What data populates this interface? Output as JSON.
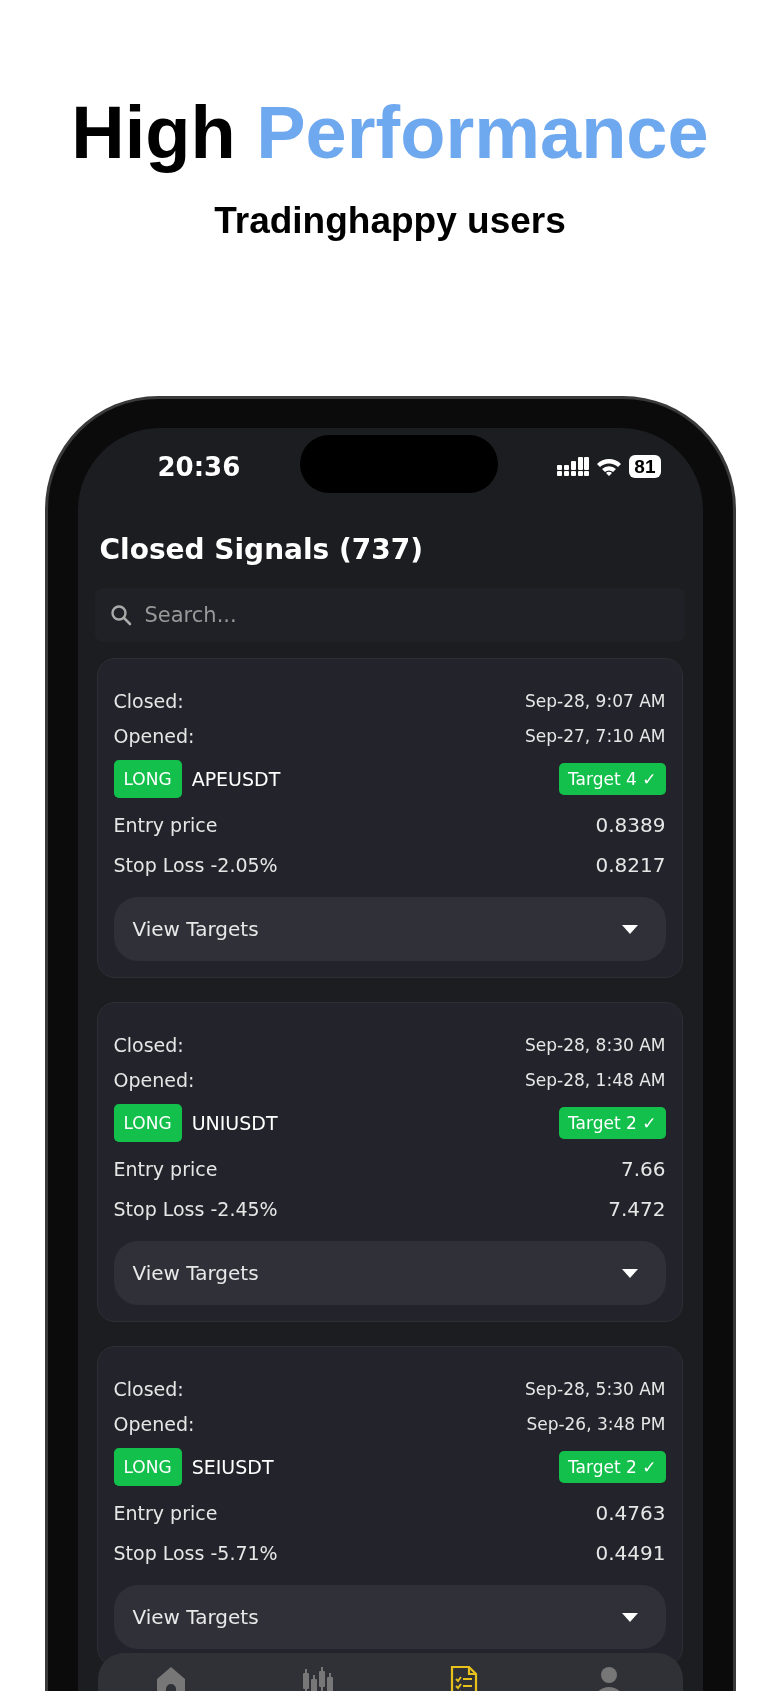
{
  "headline": {
    "text": "High",
    "highlight": "Performance"
  },
  "subtitle": "Tradinghappy users",
  "status_bar": {
    "time": "20:36",
    "battery": "81"
  },
  "title": "Closed Signals (737)",
  "search": {
    "placeholder": "Search..."
  },
  "signals": [
    {
      "closed_label": "Closed:",
      "closed": "Sep-28, 9:07 AM",
      "opened_label": "Opened:",
      "opened": "Sep-27, 7:10 AM",
      "side": "LONG",
      "pair": "APEUSDT",
      "result": "Target 4 ✓",
      "entry_label": "Entry price",
      "entry": "0.8389",
      "stop_label": "Stop Loss -2.05%",
      "stop": "0.8217",
      "button": "View Targets"
    },
    {
      "closed_label": "Closed:",
      "closed": "Sep-28, 8:30 AM",
      "opened_label": "Opened:",
      "opened": "Sep-28, 1:48 AM",
      "side": "LONG",
      "pair": "UNIUSDT",
      "result": "Target 2 ✓",
      "entry_label": "Entry price",
      "entry": "7.66",
      "stop_label": "Stop Loss -2.45%",
      "stop": "7.472",
      "button": "View Targets"
    },
    {
      "closed_label": "Closed:",
      "closed": "Sep-28, 5:30 AM",
      "opened_label": "Opened:",
      "opened": "Sep-26, 3:48 PM",
      "side": "LONG",
      "pair": "SEIUSDT",
      "result": "Target 2 ✓",
      "entry_label": "Entry price",
      "entry": "0.4763",
      "stop_label": "Stop Loss -5.71%",
      "stop": "0.4491",
      "button": "View Targets"
    }
  ],
  "nav": [
    {
      "kind": "home",
      "selected": false
    },
    {
      "kind": "chart",
      "selected": false
    },
    {
      "kind": "list",
      "selected": true
    },
    {
      "kind": "profile",
      "selected": false
    }
  ]
}
